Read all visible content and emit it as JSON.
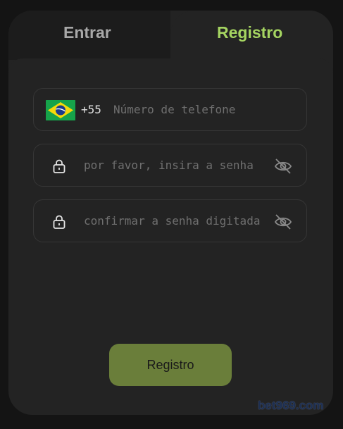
{
  "tabs": {
    "login_label": "Entrar",
    "register_label": "Registro",
    "active": "Registro"
  },
  "phone": {
    "country_code": "+55",
    "placeholder": "Número de telefone",
    "flag": "brazil-flag-icon"
  },
  "password": {
    "placeholder": "por favor, insira a senha",
    "icon": "lock-icon",
    "toggle_icon": "eye-off-icon"
  },
  "confirm_password": {
    "placeholder": "confirmar a senha digitada",
    "icon": "lock-icon",
    "toggle_icon": "eye-off-icon"
  },
  "submit_label": "Registro",
  "watermark": "bet969.com",
  "colors": {
    "accent": "#a5d461",
    "button": "#6a7e3a",
    "background": "#141414",
    "card": "#232323"
  }
}
